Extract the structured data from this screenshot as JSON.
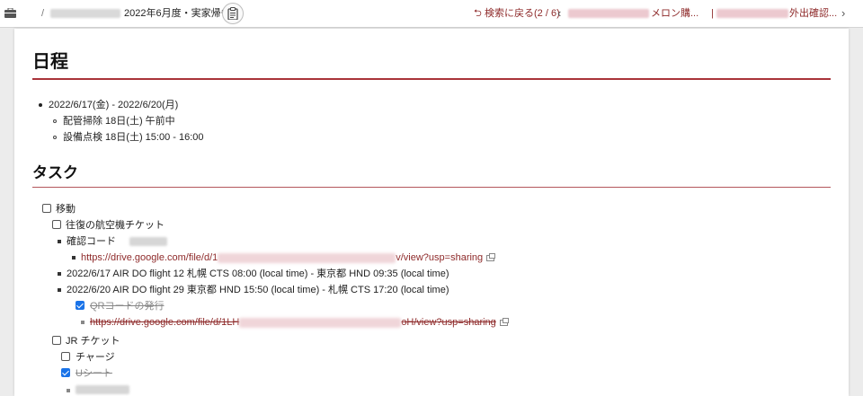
{
  "topbar": {
    "slash": "/",
    "title": "2022年6月度・実家帰省",
    "clipboard_icon": "clipboard-icon",
    "back_label": "検索に戻る(2 / 6)",
    "prev_suffix": "メロン購...",
    "next_bar": "|",
    "next_suffix": "外出確認...",
    "chevron_left": "‹",
    "chevron_right": "›"
  },
  "section_schedule": {
    "heading": "日程",
    "period": "2022/6/17(金) - 2022/6/20(月)",
    "items": [
      "配管掃除 18日(土) 午前中",
      "設備点検 18日(土) 15:00 - 16:00"
    ]
  },
  "section_tasks": {
    "heading": "タスク",
    "move": {
      "label": "移動",
      "checked": false
    },
    "flight": {
      "label": "往復の航空機チケット",
      "checked": false
    },
    "confirm_code_label": "確認コード",
    "link1_prefix": "https://drive.google.com/file/d/1",
    "link1_suffix": "v/view?usp=sharing",
    "flight1": "2022/6/17 AIR DO flight 12 札幌 CTS 08:00 (local time) - 東京都 HND 09:35 (local time)",
    "flight2": "2022/6/20 AIR DO flight 29 東京都 HND 15:50 (local time) - 札幌 CTS 17:20 (local time)",
    "qr": {
      "label": "QRコードの発行",
      "checked": true
    },
    "link2_prefix": "https://drive.google.com/file/d/1LH",
    "link2_suffix": "oH/view?usp=sharing",
    "jr": {
      "label": "JR チケット",
      "checked": false
    },
    "charge": {
      "label": "チャージ",
      "checked": false
    },
    "useat": {
      "label": "Uシート",
      "checked": true
    }
  }
}
